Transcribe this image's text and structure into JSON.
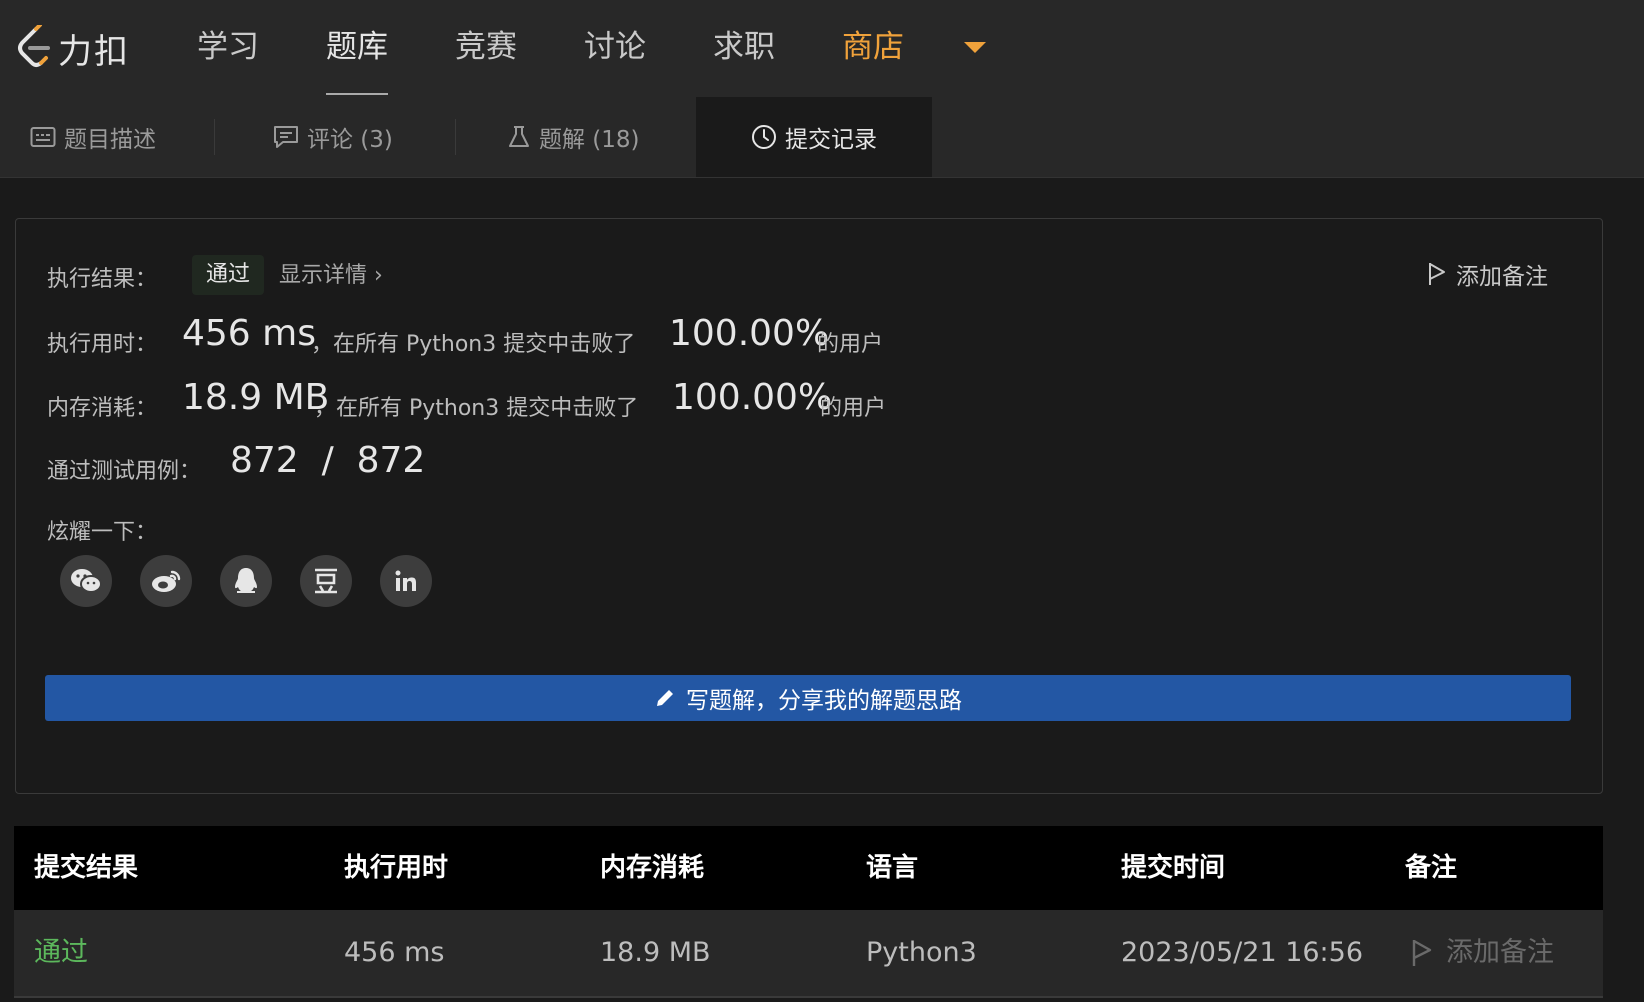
{
  "nav": {
    "logo_text": "力扣",
    "items": [
      {
        "label": "学习"
      },
      {
        "label": "题库"
      },
      {
        "label": "竞赛"
      },
      {
        "label": "讨论"
      },
      {
        "label": "求职"
      },
      {
        "label": "商店"
      }
    ]
  },
  "tabs": [
    {
      "label": "题目描述",
      "icon": "description-icon"
    },
    {
      "label": "评论 (3)",
      "icon": "comment-icon"
    },
    {
      "label": "题解 (18)",
      "icon": "flask-icon"
    },
    {
      "label": "提交记录",
      "icon": "clock-icon"
    }
  ],
  "result": {
    "status_label": "执行结果：",
    "status_value": "通过",
    "detail_link": "显示详情 ›",
    "add_note": "添加备注",
    "runtime_label": "执行用时：",
    "runtime_value": "456 ms",
    "runtime_mid": "，在所有 Python3 提交中击败了",
    "runtime_pct": "100.00%",
    "runtime_tail": "的用户",
    "memory_label": "内存消耗：",
    "memory_value": "18.9 MB",
    "memory_mid": "，在所有 Python3 提交中击败了",
    "memory_pct": "100.00%",
    "memory_tail": "的用户",
    "cases_label": "通过测试用例：",
    "cases_value": "872  /  872",
    "share_label": "炫耀一下：",
    "share_icons": [
      "wechat-icon",
      "weibo-icon",
      "qq-icon",
      "douban-icon",
      "linkedin-icon"
    ],
    "write_button": "写题解，分享我的解题思路"
  },
  "table": {
    "headers": [
      "提交结果",
      "执行用时",
      "内存消耗",
      "语言",
      "提交时间",
      "备注"
    ],
    "rows": [
      {
        "result": "通过",
        "runtime": "456 ms",
        "memory": "18.9 MB",
        "language": "Python3",
        "time": "2023/05/21 16:56",
        "note": "添加备注"
      }
    ]
  },
  "colors": {
    "accent": "#f0a23b",
    "pass": "#5cb85c",
    "button": "#2357a4"
  }
}
